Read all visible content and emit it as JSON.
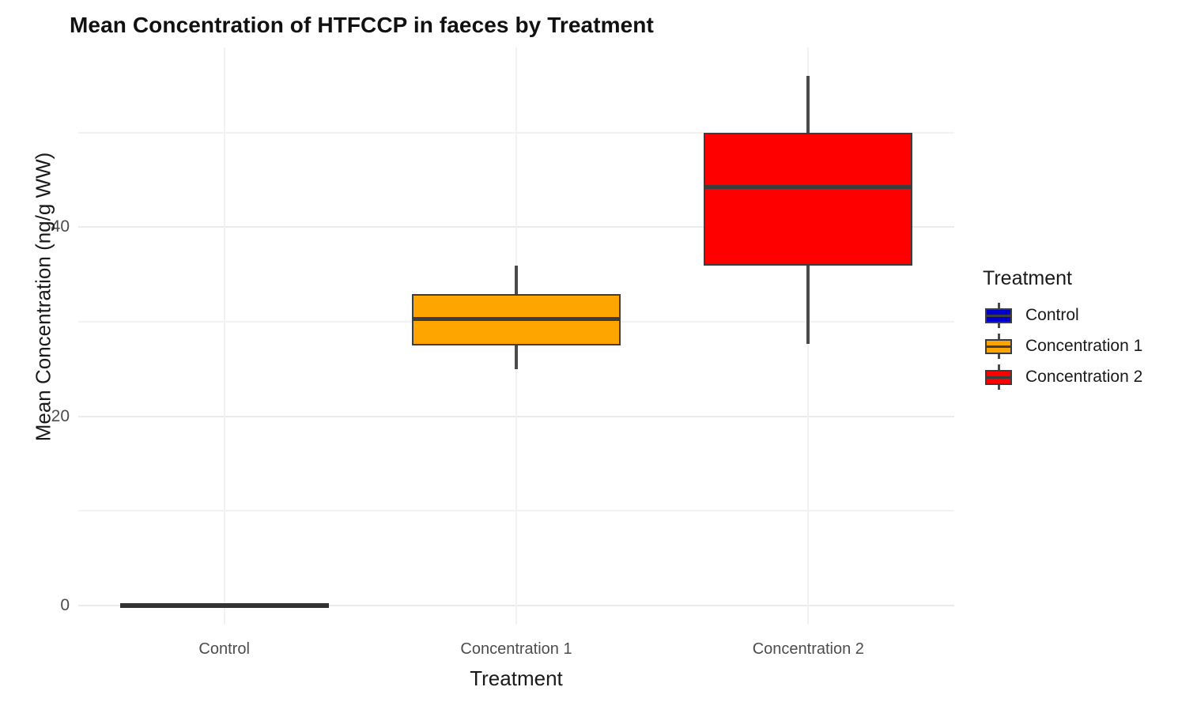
{
  "chart_data": {
    "type": "box",
    "title": "Mean Concentration of HTFCCP in faeces by Treatment",
    "xlabel": "Treatment",
    "ylabel": "Mean Concentration (ng/g WW)",
    "categories": [
      "Control",
      "Concentration 1",
      "Concentration 2"
    ],
    "ylim": [
      -2,
      59
    ],
    "ytick_labels": [
      "0",
      "20",
      "40"
    ],
    "ytick_values": [
      0,
      20,
      40
    ],
    "minor_gridline_values": [
      10,
      30,
      50
    ],
    "grid": true,
    "legend_position": "right",
    "legend_title": "Treatment",
    "series": [
      {
        "name": "Control",
        "color": "#0000CC",
        "box_color": "#333333",
        "min": 0,
        "q1": 0,
        "median": 0,
        "q3": 0,
        "max": 0
      },
      {
        "name": "Concentration 1",
        "color": "#FFA500",
        "min": 25.0,
        "q1": 27.5,
        "median": 30.3,
        "q3": 32.9,
        "max": 35.9
      },
      {
        "name": "Concentration 2",
        "color": "#FF0000",
        "min": 27.7,
        "q1": 35.9,
        "median": 44.3,
        "q3": 50.0,
        "max": 56.0
      }
    ]
  },
  "title": "Mean Concentration of HTFCCP in faeces by Treatment",
  "axes": {
    "x_title": "Treatment",
    "y_title": "Mean Concentration (ng/g WW)",
    "x_ticks": [
      "Control",
      "Concentration 1",
      "Concentration 2"
    ],
    "y_ticks": [
      "0",
      "20",
      "40"
    ]
  },
  "legend": {
    "title": "Treatment",
    "items": [
      {
        "label": "Control",
        "color": "#0000CC"
      },
      {
        "label": "Concentration 1",
        "color": "#FFA500"
      },
      {
        "label": "Concentration 2",
        "color": "#FF0000"
      }
    ]
  }
}
